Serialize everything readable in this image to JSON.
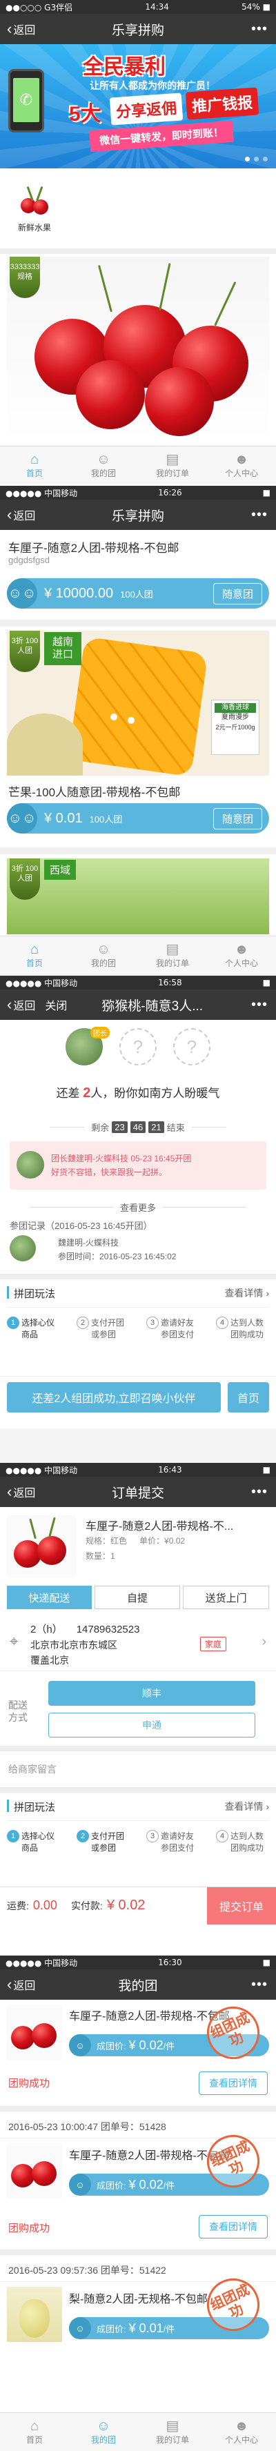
{
  "s1": {
    "status": {
      "carrier": "●●○○○ G3伴侣",
      "time": "14:34",
      "battery": "54% ■"
    },
    "nav": {
      "back": "返回",
      "title": "乐享拼购"
    },
    "banner": {
      "line1": "全民暴利",
      "line2": "让所有人都成为你的推广员！",
      "red_big": "5大",
      "slogan1": "分享返佣",
      "slogan2": "推广钱报",
      "ribbon": "微信一键转发，即时到账！"
    },
    "category": {
      "label": "新鲜水果"
    },
    "corner_badge": "3333333 规格",
    "tabs": [
      "首页",
      "我的团",
      "我的订单",
      "个人中心"
    ]
  },
  "s2": {
    "status": {
      "carrier": "●●●●● 中国移动",
      "wifi": "≋",
      "time": "16:26",
      "battery": "■"
    },
    "nav": {
      "back": "返回",
      "title": "乐享拼购"
    },
    "p1": {
      "title": "车厘子-随意2人团-带规格-不包邮",
      "sub": "gdgdsfgsd",
      "price": "¥ 10000.00",
      "people": "100人团",
      "action": "随意团"
    },
    "p2": {
      "badge": "3折 100人团",
      "country": "越南 进口",
      "tag_green": "海香进球",
      "tag_small1": "夏雨漫步",
      "tag_small2": "2元一斤1000g",
      "title": "芒果-100人随意团-带规格-不包邮",
      "price": "¥ 0.01",
      "people": "100人团",
      "action": "随意团"
    },
    "p3": {
      "badge": "3折 100人团",
      "country": "西域"
    },
    "tabs": [
      "首页",
      "我的团",
      "我的订单",
      "个人中心"
    ]
  },
  "s3": {
    "status": {
      "carrier": "●●●●● 中国移动",
      "time": "16:58",
      "battery": "■"
    },
    "nav": {
      "back": "返回",
      "close": "关闭",
      "title": "猕猴桃-随意3人..."
    },
    "leader_tag": "团长",
    "need": {
      "prefix": "还差",
      "num": "2",
      "mid": "人，盼你如南方人盼暖气"
    },
    "countdown": {
      "prefix": "剩余",
      "h": "23",
      "m": "46",
      "s": "21",
      "suffix": "结束"
    },
    "notice": {
      "line1": "团长魏建明-火蝶科技 05-23 16:45开团",
      "line2": "好货不容错，快来跟我一起拼。"
    },
    "more": "查看更多",
    "record": {
      "title": "参团记录（2016-05-23 16:45开团）",
      "name": "魏建明-火蝶科技",
      "time_label": "参团时间：",
      "time": "2016-05-23 16:45:02"
    },
    "rules": {
      "title": "拼团玩法",
      "link": "查看详情"
    },
    "steps": [
      {
        "n": "1",
        "t": "选择心仪商品"
      },
      {
        "n": "2",
        "t": "支付开团或参团"
      },
      {
        "n": "3",
        "t": "邀请好友参团支付"
      },
      {
        "n": "4",
        "t": "达到人数团购成功"
      }
    ],
    "bottom": {
      "join": "还差2人组团成功,立即召唤小伙伴",
      "home": "首页"
    }
  },
  "s4": {
    "status": {
      "carrier": "●●●●● 中国移动",
      "time": "16:43",
      "battery": "■"
    },
    "nav": {
      "back": "返回",
      "title": "订单提交"
    },
    "item": {
      "title": "车厘子-随意2人团-带规格-不...",
      "spec_label": "规格：",
      "spec": "红色",
      "fee": "单价：¥0.02",
      "qty": "数量：1"
    },
    "delivery": [
      "快递配送",
      "自提",
      "送货上门"
    ],
    "address": {
      "name": "2（h）",
      "phone": "14789632523",
      "line1": "北京市北京市东城区",
      "line2": "覆盖北京",
      "tag": "家庭"
    },
    "ship": {
      "label": "配送方式",
      "opt1": "顺丰",
      "opt2": "申通"
    },
    "remark": "给商家留言",
    "rules": {
      "title": "拼团玩法",
      "link": "查看详情"
    },
    "steps": [
      {
        "n": "1",
        "t": "选择心仪商品"
      },
      {
        "n": "2",
        "t": "支付开团或参团"
      },
      {
        "n": "3",
        "t": "邀请好友参团支付"
      },
      {
        "n": "4",
        "t": "达到人数团购成功"
      }
    ],
    "bottom": {
      "ship_label": "运费:",
      "ship": "0.00",
      "pay_label": "实付款:",
      "pay": "¥ 0.02",
      "submit": "提交订单"
    }
  },
  "s5": {
    "status": {
      "carrier": "●●●●● 中国移动",
      "time": "16:30",
      "battery": "■"
    },
    "nav": {
      "back": "返回",
      "title": "我的团"
    },
    "groups": [
      {
        "title": "车厘子-随意2人团-带规格-不包邮",
        "price_label": "成团价:",
        "price": "¥ 0.02",
        "unit": "/件",
        "status": "团购成功",
        "btn": "查看团详情",
        "stamp": "组团成功"
      },
      {
        "header": "2016-05-23 10:00:47 团单号：51428",
        "title": "车厘子-随意2人团-带规格-不包邮",
        "price_label": "成团价:",
        "price": "¥ 0.02",
        "unit": "/件",
        "status": "团购成功",
        "btn": "查看团详情",
        "stamp": "组团成功"
      },
      {
        "header": "2016-05-23 09:57:36 团单号：51422",
        "title": "梨-随意2人团-无规格-不包邮",
        "price_label": "成团价:",
        "price": "¥ 0.01",
        "unit": "/件",
        "stamp": "组团成功"
      }
    ],
    "tabs": [
      "首页",
      "我的团",
      "我的订单",
      "个人中心"
    ]
  }
}
